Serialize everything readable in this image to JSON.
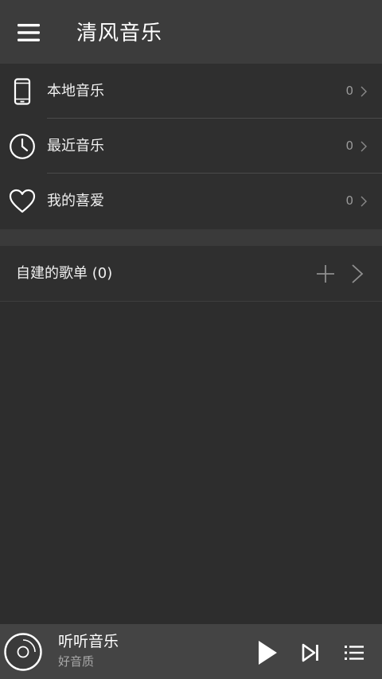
{
  "header": {
    "title": "清风音乐",
    "menu_icon": "hamburger-menu-icon"
  },
  "library": {
    "items": [
      {
        "label": "本地音乐",
        "count": "0",
        "icon": "phone-icon"
      },
      {
        "label": "最近音乐",
        "count": "0",
        "icon": "clock-icon"
      },
      {
        "label": "我的喜爱",
        "count": "0",
        "icon": "heart-icon"
      }
    ]
  },
  "playlists": {
    "title": "自建的歌单 (0)",
    "add_icon": "plus-icon",
    "more_icon": "chevron-right-icon"
  },
  "player": {
    "song_title": "听听音乐",
    "song_subtitle": "好音质",
    "icons": [
      "disc-icon",
      "play-icon",
      "skip-next-icon",
      "playlist-queue-icon"
    ]
  },
  "colors": {
    "topbar": "#3c3c3c",
    "background": "#2d2d2d",
    "player_bar": "#444444",
    "text_primary": "#ffffff",
    "text_secondary": "#9a9a9a"
  }
}
